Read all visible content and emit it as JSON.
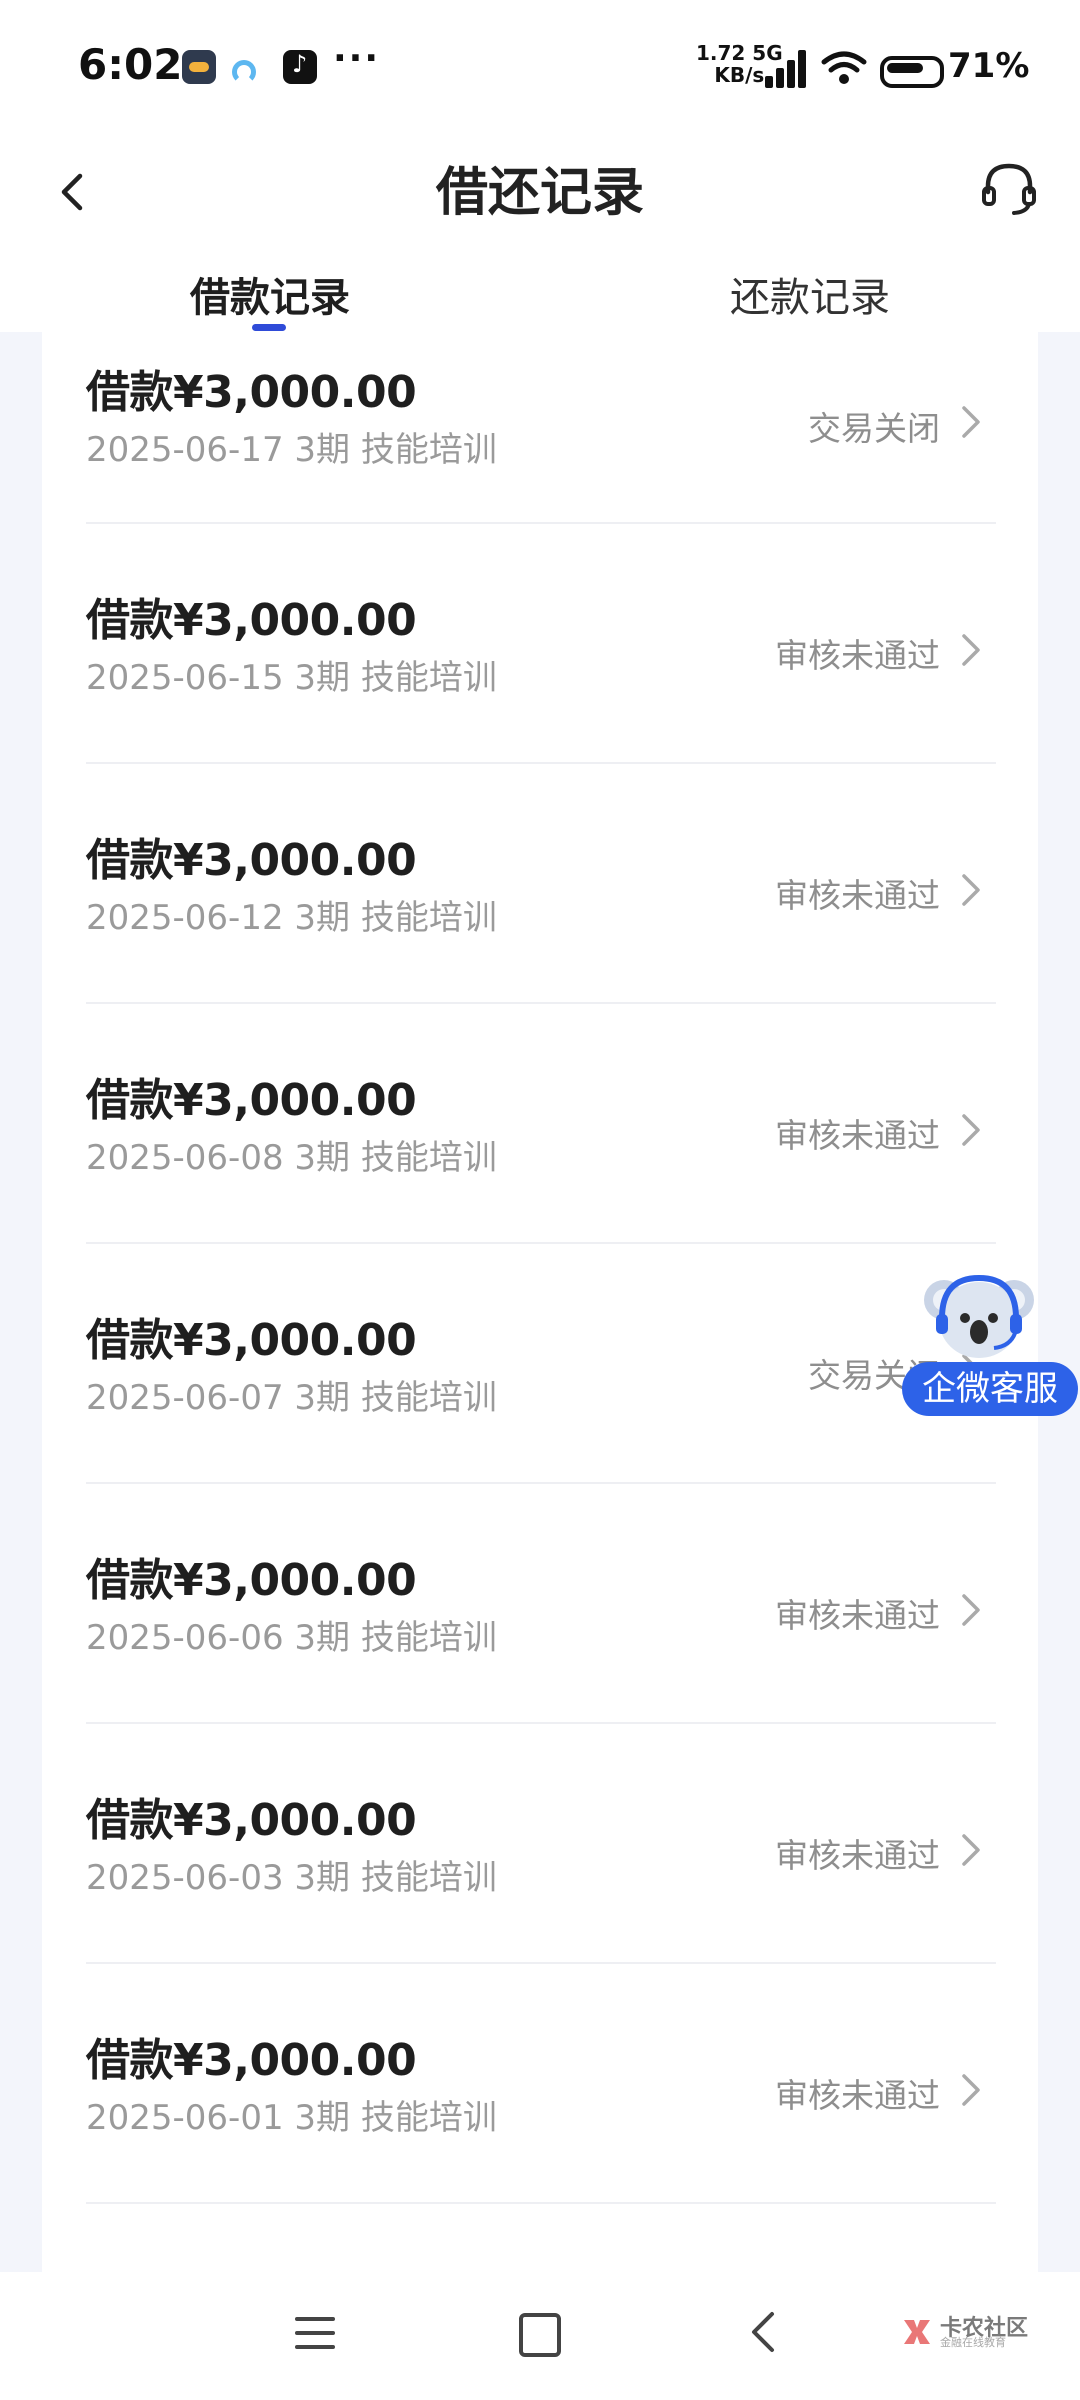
{
  "status_bar": {
    "time": "6:02",
    "overflow_dots": "···",
    "speed_top": "1.72 5G",
    "speed_bottom": "KB/s",
    "battery": "71%"
  },
  "header": {
    "title": "借还记录"
  },
  "tabs": [
    {
      "label": "借款记录",
      "active": true
    },
    {
      "label": "还款记录",
      "active": false
    }
  ],
  "records": [
    {
      "amount": "借款¥3,000.00",
      "meta": "2025-06-17 3期  技能培训",
      "status": "交易关闭"
    },
    {
      "amount": "借款¥3,000.00",
      "meta": "2025-06-15 3期  技能培训",
      "status": "审核未通过"
    },
    {
      "amount": "借款¥3,000.00",
      "meta": "2025-06-12 3期  技能培训",
      "status": "审核未通过"
    },
    {
      "amount": "借款¥3,000.00",
      "meta": "2025-06-08 3期  技能培训",
      "status": "审核未通过"
    },
    {
      "amount": "借款¥3,000.00",
      "meta": "2025-06-07 3期  技能培训",
      "status": "交易关闭"
    },
    {
      "amount": "借款¥3,000.00",
      "meta": "2025-06-06 3期  技能培训",
      "status": "审核未通过"
    },
    {
      "amount": "借款¥3,000.00",
      "meta": "2025-06-03 3期  技能培训",
      "status": "审核未通过"
    },
    {
      "amount": "借款¥3,000.00",
      "meta": "2025-06-01 3期  技能培训",
      "status": "审核未通过"
    }
  ],
  "floating_service": {
    "label": "企微客服"
  },
  "watermark": {
    "name": "卡农社区",
    "tagline": "金融在线教育"
  },
  "colors": {
    "accent": "#2f4bd8",
    "badge": "#2d62e8",
    "status_text": "#8e8e8e",
    "page_bg": "#f3f5fb"
  }
}
